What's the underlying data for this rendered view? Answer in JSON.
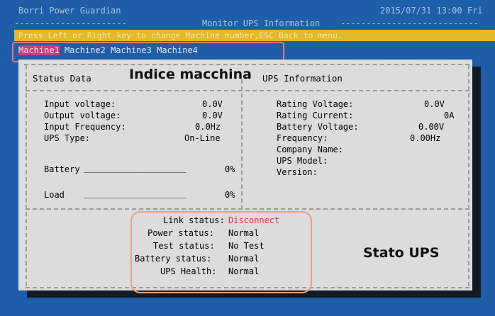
{
  "app": {
    "title": "Borri Power Guardian",
    "datetime": "2015/07/31 13:00 Fri",
    "screen_title": "Monitor UPS Information"
  },
  "hint": "Press Left or Right key to change Machine number,ESC Back to menu.",
  "tabs": [
    {
      "label": "Machine1",
      "active": true
    },
    {
      "label": "Machine2",
      "active": false
    },
    {
      "label": "Machine3",
      "active": false
    },
    {
      "label": "Machine4",
      "active": false
    }
  ],
  "annotations": {
    "machine_index": "Indice macchina",
    "ups_status": "Stato UPS"
  },
  "status_data": {
    "title": "Status Data",
    "input_voltage_label": "Input voltage:",
    "input_voltage_value": "0.0V",
    "output_voltage_label": "Output voltage:",
    "output_voltage_value": "0.0V",
    "input_frequency_label": "Input Frequency:",
    "input_frequency_value": "0.0Hz",
    "ups_type_label": "UPS Type:",
    "ups_type_value": "On-Line",
    "battery_label": "Battery",
    "battery_bar": "____________________",
    "battery_value": "0%",
    "load_label": "Load",
    "load_bar": "____________________",
    "load_value": "0%"
  },
  "ups_info": {
    "title": "UPS Information",
    "rating_voltage_label": "Rating Voltage:",
    "rating_voltage_value": "0.0V",
    "rating_current_label": "Rating Current:",
    "rating_current_value": "0A",
    "battery_voltage_label": "Battery Voltage:",
    "battery_voltage_value": "0.00V",
    "frequency_label": "Frequency:",
    "frequency_value": "0.00Hz",
    "company_name_label": "Company Name:",
    "ups_model_label": "UPS Model:",
    "version_label": "Version:"
  },
  "ups_status": {
    "link_label": "Link status:",
    "link_value": "Disconnect",
    "power_label": "Power status:",
    "power_value": "Normal",
    "test_label": "Test status:",
    "test_value": "No Test",
    "battery_label": "Battery status:",
    "battery_value": "Normal",
    "health_label": "UPS Health:",
    "health_value": "Normal"
  },
  "colors": {
    "background": "#1e5ea8",
    "panel": "#dcdcdc",
    "hint_bar": "#e2b92a",
    "active_tab": "#c8407d",
    "disconnect": "#e0343a",
    "highlight_box": "#e47a7a"
  }
}
